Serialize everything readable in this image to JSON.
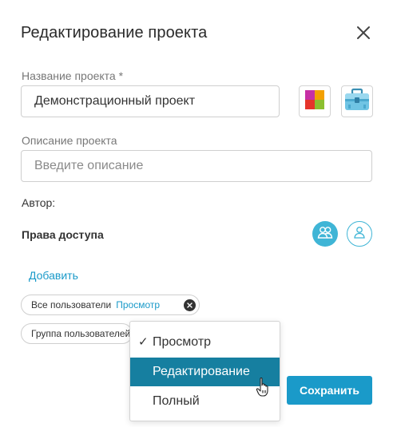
{
  "dialog": {
    "title": "Редактирование проекта",
    "close_icon": "close-icon"
  },
  "form": {
    "name_label": "Название проекта *",
    "name_value": "Демонстрационный проект",
    "description_label": "Описание проекта",
    "description_placeholder": "Введите описание",
    "color_icon": "color-palette-icon",
    "case_icon": "briefcase-icon",
    "author_label": "Автор:"
  },
  "access": {
    "title": "Права доступа",
    "group_toggle_icon": "users-group-icon",
    "user_toggle_icon": "user-icon",
    "add_link": "Добавить",
    "entries": [
      {
        "name": "Все пользователи",
        "permission": "Просмотр"
      },
      {
        "name": "Группа пользователей",
        "permission": ""
      }
    ]
  },
  "dropdown": {
    "options": [
      "Просмотр",
      "Редактирование",
      "Полный"
    ],
    "checked": "Просмотр",
    "highlighted": "Редактирование",
    "check_mark": "✓"
  },
  "footer": {
    "save_label": "Сохранить"
  },
  "colors": {
    "accent": "#1a9ac9",
    "accent_light": "#3fb5d6",
    "highlight": "#167fa0"
  }
}
